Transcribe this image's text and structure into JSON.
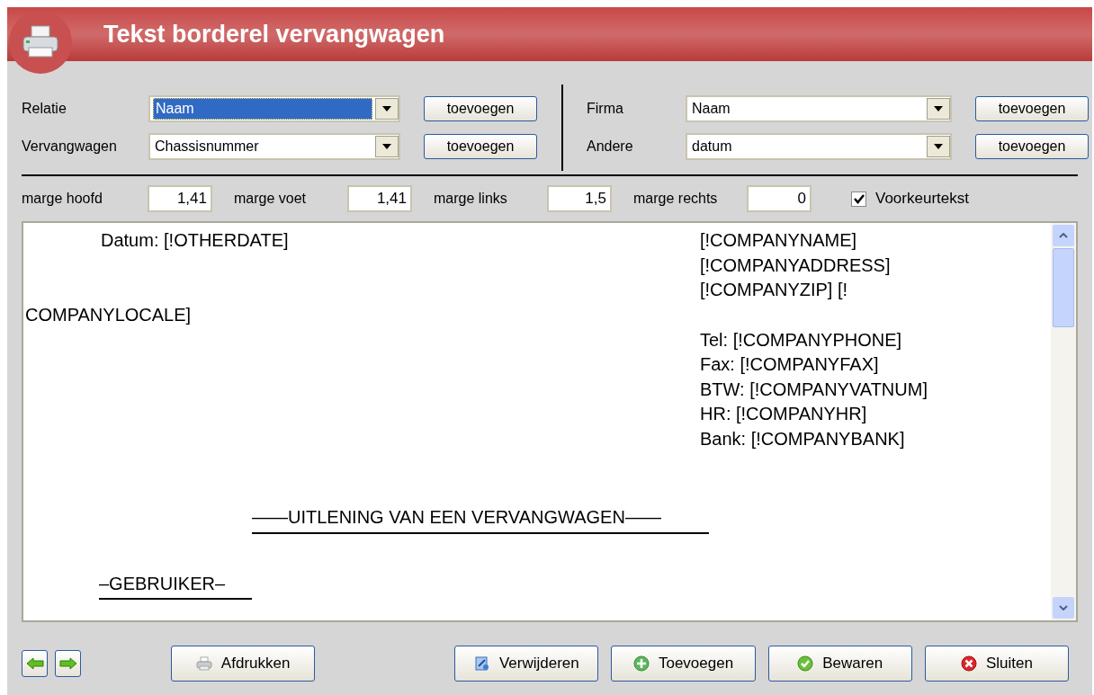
{
  "window": {
    "title": "Tekst borderel vervangwagen"
  },
  "selectors": [
    {
      "label": "Relatie",
      "value": "Naam",
      "focused": true,
      "button": "toevoegen"
    },
    {
      "label": "Vervangwagen",
      "value": "Chassisnummer",
      "focused": false,
      "button": "toevoegen"
    },
    {
      "label": "Firma",
      "value": "Naam",
      "focused": false,
      "button": "toevoegen"
    },
    {
      "label": "Andere",
      "value": "datum",
      "focused": false,
      "button": "toevoegen"
    }
  ],
  "margins": [
    {
      "label": "marge hoofd",
      "value": "1,41"
    },
    {
      "label": "marge voet",
      "value": "1,41"
    },
    {
      "label": "marge links",
      "value": "1,5"
    },
    {
      "label": "marge rechts",
      "value": "0"
    }
  ],
  "preferred_text": {
    "label": "Voorkeurtekst",
    "checked": true
  },
  "document": {
    "date_line": "Datum: [!OTHERDATE]",
    "locale_line": "COMPANYLOCALE]",
    "company_lines": [
      "[!COMPANYNAME]",
      "[!COMPANYADDRESS]",
      "[!COMPANYZIP] [!"
    ],
    "contact_lines": [
      "Tel: [!COMPANYPHONE]",
      "Fax: [!COMPANYFAX]",
      "BTW: [!COMPANYVATNUM]",
      "HR: [!COMPANYHR]",
      "Bank: [!COMPANYBANK]"
    ],
    "heading": "——UITLENING VAN EEN VERVANGWAGEN——",
    "subheading": "–GEBRUIKER–"
  },
  "nav_buttons": [
    {
      "kind": "back"
    },
    {
      "kind": "forward"
    }
  ],
  "buttons": [
    {
      "kind": "print",
      "label": "Afdrukken"
    },
    {
      "kind": "delete",
      "label": "Verwijderen"
    },
    {
      "kind": "add",
      "label": "Toevoegen"
    },
    {
      "kind": "save",
      "label": "Bewaren"
    },
    {
      "kind": "close",
      "label": "Sluiten"
    }
  ]
}
